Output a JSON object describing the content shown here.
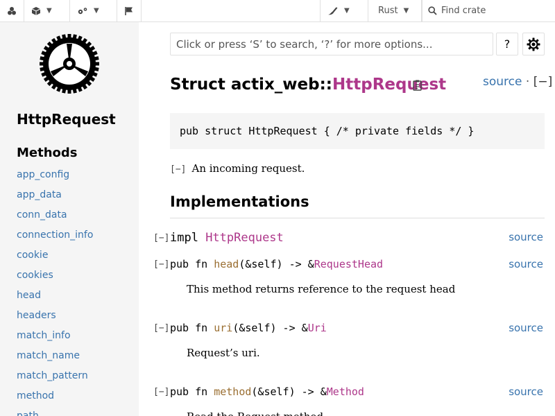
{
  "topbar": {
    "lang_label": "Rust",
    "find_crate_placeholder": "Find crate"
  },
  "sidebar": {
    "crate_title": "HttpRequest",
    "methods_heading": "Methods",
    "methods": [
      "app_config",
      "app_data",
      "conn_data",
      "connection_info",
      "cookie",
      "cookies",
      "head",
      "headers",
      "match_info",
      "match_name",
      "match_pattern",
      "method",
      "path"
    ]
  },
  "main": {
    "search_placeholder": "Click or press ‘S’ to search, ‘?’ for more options...",
    "help_label": "?",
    "title_prefix": "Struct actix_web::",
    "title_name": "HttpRequest",
    "source_label": "source",
    "source_sep": " · ",
    "collapse_label": "[−]",
    "declaration": "pub struct HttpRequest { /* private fields */ }",
    "toggle_label": "[−]",
    "doc_summary": "An incoming request.",
    "implementations_heading": "Implementations",
    "impl": {
      "kw": "impl ",
      "name": "HttpRequest",
      "source": "source"
    },
    "methods": [
      {
        "prefix": "pub fn ",
        "name": "head",
        "mid": "(&self) -> &",
        "ret": "RequestHead",
        "source": "source",
        "doc": "This method returns reference to the request head"
      },
      {
        "prefix": "pub fn ",
        "name": "uri",
        "mid": "(&self) -> &",
        "ret": "Uri",
        "source": "source",
        "doc": "Request’s uri."
      },
      {
        "prefix": "pub fn ",
        "name": "method",
        "mid": "(&self) -> &",
        "ret": "Method",
        "source": "source",
        "doc": "Read the Request method."
      }
    ]
  },
  "colors": {
    "link": "#3873ad",
    "type": "#ad378a",
    "function": "#9a6e31",
    "sidebar_bg": "#f5f5f5"
  },
  "icons": [
    "crates-icon",
    "cube-icon",
    "gears-icon",
    "flag-icon",
    "theme-brush-icon",
    "search-icon",
    "copy-icon",
    "settings-gear-icon",
    "rust-logo"
  ]
}
